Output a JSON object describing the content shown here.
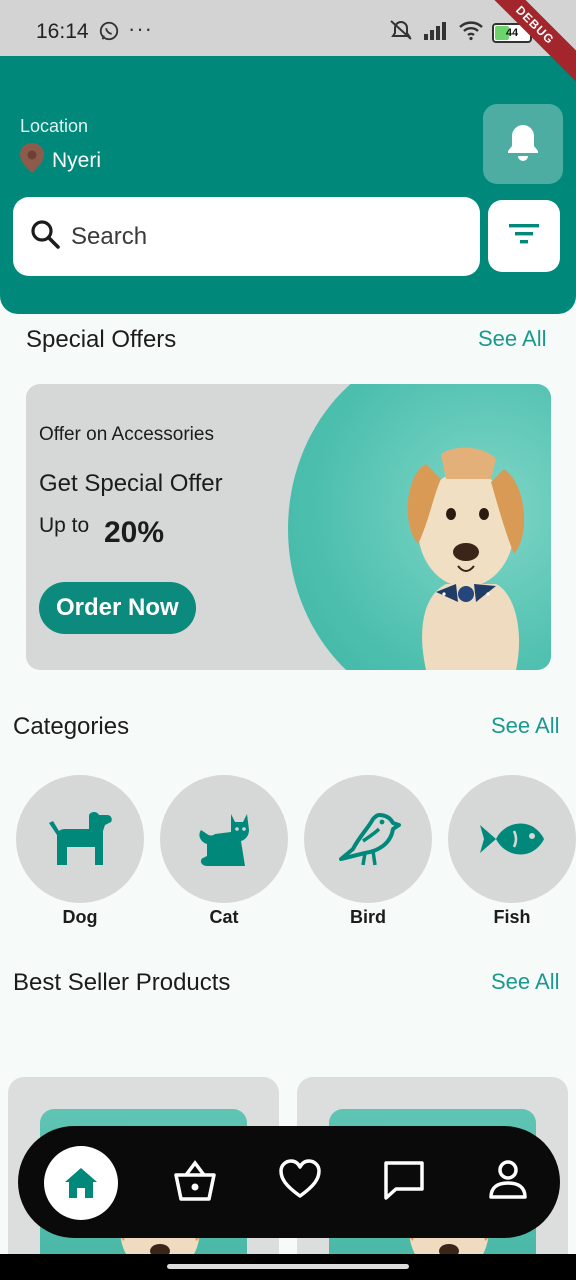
{
  "status_bar": {
    "time": "16:14",
    "dots": "···",
    "battery_level": "44",
    "battery_pct": 44,
    "debug_label": "DEBUG"
  },
  "header": {
    "location_label": "Location",
    "location_name": "Nyeri",
    "search_placeholder": "Search"
  },
  "special_offers": {
    "title": "Special Offers",
    "see_all": "See All",
    "offer": {
      "subtitle": "Offer on Accessories",
      "title": "Get Special Offer",
      "up_to": "Up to",
      "percent": "20%",
      "button": "Order Now"
    }
  },
  "categories": {
    "title": "Categories",
    "see_all": "See All",
    "items": [
      {
        "label": "Dog",
        "icon": "dog-icon"
      },
      {
        "label": "Cat",
        "icon": "cat-icon"
      },
      {
        "label": "Bird",
        "icon": "bird-icon"
      },
      {
        "label": "Fish",
        "icon": "fish-icon"
      }
    ]
  },
  "best_sellers": {
    "title": "Best Seller Products",
    "see_all": "See All"
  },
  "bottom_nav": {
    "items": [
      {
        "name": "home",
        "icon": "home-icon",
        "active": true
      },
      {
        "name": "cart",
        "icon": "basket-icon"
      },
      {
        "name": "favorites",
        "icon": "heart-icon"
      },
      {
        "name": "messages",
        "icon": "chat-icon"
      },
      {
        "name": "profile",
        "icon": "user-icon"
      }
    ]
  },
  "colors": {
    "primary": "#00897b",
    "accent": "#1a9a8c",
    "card_bg": "#d6d7d7",
    "nav_bg": "#0a0a0a"
  }
}
